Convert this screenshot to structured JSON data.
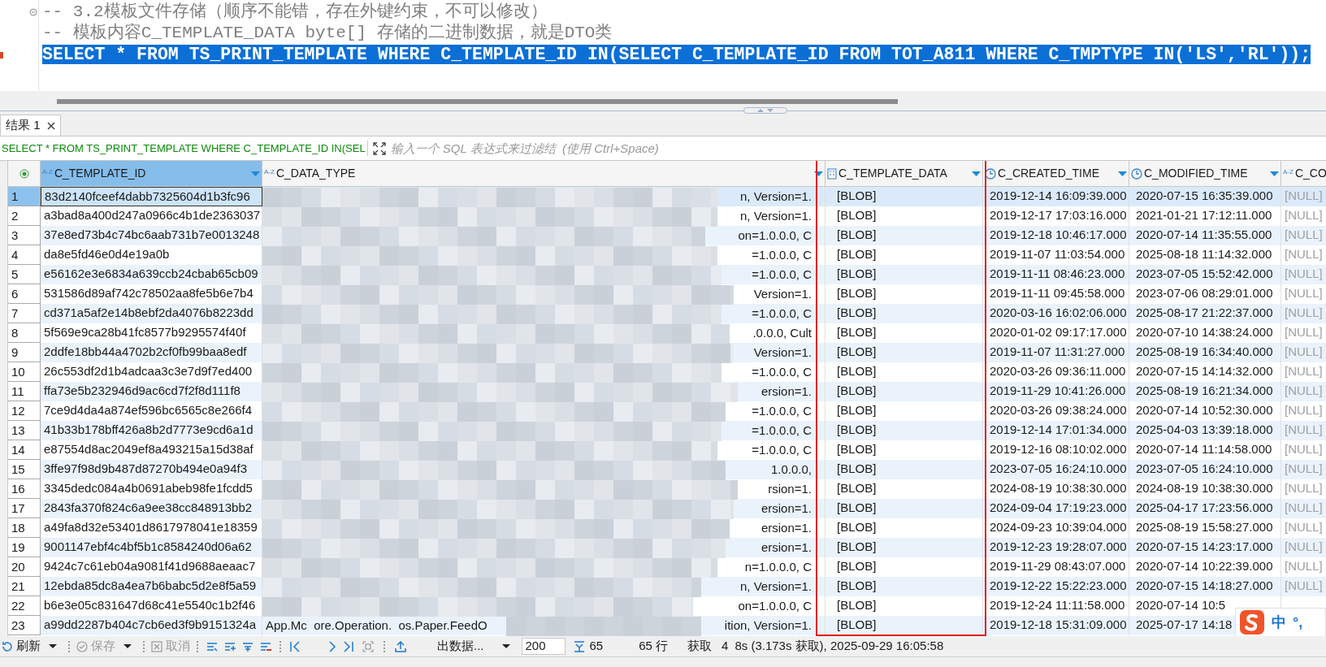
{
  "editor": {
    "lines": [
      {
        "kind": "comment",
        "text": "-- 3.2模板文件存储（顺序不能错，存在外键约束，不可以修改）"
      },
      {
        "kind": "comment",
        "text": "-- 模板内容C_TEMPLATE_DATA byte[] 存储的二进制数据，就是DTO类"
      },
      {
        "kind": "code",
        "selected": true,
        "text": "SELECT * FROM TS_PRINT_TEMPLATE WHERE C_TEMPLATE_ID IN(SELECT C_TEMPLATE_ID FROM TOT_A811 WHERE C_TMPTYPE IN('LS','RL'));"
      }
    ]
  },
  "results_tab": {
    "label": "结果 1",
    "selected": true
  },
  "filter": {
    "query_text": "SELECT * FROM TS_PRINT_TEMPLATE WHERE C_TEMPLATE_ID IN(SEL",
    "placeholder": "输入一个 SQL 表达式来过滤结  (使用 Ctrl+Space)"
  },
  "table": {
    "columns": [
      {
        "name": "C_TEMPLATE_ID",
        "kind": "string",
        "icon_text": "A-Z",
        "selected": true
      },
      {
        "name": "C_DATA_TYPE",
        "kind": "string",
        "icon_text": "A-Z",
        "selected": false
      },
      {
        "name": "C_TEMPLATE_DATA",
        "kind": "binary",
        "selected": false
      },
      {
        "name": "C_CREATED_TIME",
        "kind": "datetime",
        "selected": false
      },
      {
        "name": "C_MODIFIED_TIME",
        "kind": "datetime",
        "selected": false
      },
      {
        "name": "C_CO",
        "kind": "string",
        "icon_text": "A-Z",
        "selected": false
      }
    ],
    "rows": [
      {
        "number": "1",
        "selected": true,
        "template_id": "83d2140fceef4dabb7325604d1b3fc96",
        "data_type_tail": "n, Version=1.",
        "template_data": "[BLOB]",
        "created_time": "2019-12-14 16:09:39.000",
        "modified_time": "2020-07-15 16:35:39.000",
        "column_6": "[NULL]"
      },
      {
        "number": "2",
        "selected": false,
        "template_id": "a3bad8a400d247a0966c4b1de2363037",
        "data_type_tail": "n, Version=1.",
        "template_data": "[BLOB]",
        "created_time": "2019-12-17 17:03:16.000",
        "modified_time": "2021-01-21 17:12:11.000",
        "column_6": "[NULL]"
      },
      {
        "number": "3",
        "selected": false,
        "template_id": "37e8ed73b4c74bc6aab731b7e0013248",
        "data_type_tail": "on=1.0.0.0, C",
        "template_data": "[BLOB]",
        "created_time": "2019-12-18 10:46:17.000",
        "modified_time": "2020-07-14 11:35:55.000",
        "column_6": "[NULL]"
      },
      {
        "number": "4",
        "selected": false,
        "template_id": "da8e5fd46e0d4e19a0b",
        "data_type_tail": "=1.0.0.0, C",
        "template_data": "[BLOB]",
        "created_time": "2019-11-07 11:03:54.000",
        "modified_time": "2025-08-18 11:14:32.000",
        "column_6": "[NULL]"
      },
      {
        "number": "5",
        "selected": false,
        "template_id": "e56162e3e6834a639ccb24cbab65cb09",
        "data_type_tail": "=1.0.0.0, C",
        "template_data": "[BLOB]",
        "created_time": "2019-11-11 08:46:23.000",
        "modified_time": "2023-07-05 15:52:42.000",
        "column_6": "[NULL]"
      },
      {
        "number": "6",
        "selected": false,
        "template_id": "531586d89af742c78502aa8fe5b6e7b4",
        "data_type_tail": "Version=1.",
        "template_data": "[BLOB]",
        "created_time": "2019-11-11 09:45:58.000",
        "modified_time": "2023-07-06 08:29:01.000",
        "column_6": "[NULL]"
      },
      {
        "number": "7",
        "selected": false,
        "template_id": "cd371a5af2e14b8ebf2da4076b8223dd",
        "data_type_tail": "=1.0.0.0, C",
        "template_data": "[BLOB]",
        "created_time": "2020-03-16 16:02:06.000",
        "modified_time": "2025-08-17 21:22:37.000",
        "column_6": "[NULL]"
      },
      {
        "number": "8",
        "selected": false,
        "template_id": "5f569e9ca28b41fc8577b9295574f40f",
        "data_type_tail": ".0.0.0, Cult",
        "template_data": "[BLOB]",
        "created_time": "2020-01-02 09:17:17.000",
        "modified_time": "2020-07-10 14:38:24.000",
        "column_6": "[NULL]"
      },
      {
        "number": "9",
        "selected": false,
        "template_id": "2ddfe18bb44a4702b2cf0fb99baa8edf",
        "data_type_tail": "Version=1.",
        "template_data": "[BLOB]",
        "created_time": "2019-11-07 11:31:27.000",
        "modified_time": "2025-08-19 16:34:40.000",
        "column_6": "[NULL]"
      },
      {
        "number": "10",
        "selected": false,
        "template_id": "26c553df2d1b4adcaa3c3e7d9f7ed400",
        "data_type_tail": "=1.0.0.0, C",
        "template_data": "[BLOB]",
        "created_time": "2020-03-26 09:36:11.000",
        "modified_time": "2020-07-15 14:14:32.000",
        "column_6": "[NULL]"
      },
      {
        "number": "11",
        "selected": false,
        "template_id": "ffa73e5b232946d9ac6cd7f2f8d111f8",
        "data_type_tail": "ersion=1.",
        "template_data": "[BLOB]",
        "created_time": "2019-11-29 10:41:26.000",
        "modified_time": "2025-08-19 16:21:34.000",
        "column_6": "[NULL]"
      },
      {
        "number": "12",
        "selected": false,
        "template_id": "7ce9d4da4a874ef596bc6565c8e266f4",
        "data_type_tail": "=1.0.0.0, C",
        "template_data": "[BLOB]",
        "created_time": "2020-03-26 09:38:24.000",
        "modified_time": "2020-07-14 10:52:30.000",
        "column_6": "[NULL]"
      },
      {
        "number": "13",
        "selected": false,
        "template_id": "41b33b178bff426a8b2d7773e9cd6a1d",
        "data_type_tail": "=1.0.0.0, C",
        "template_data": "[BLOB]",
        "created_time": "2019-12-14 17:01:34.000",
        "modified_time": "2025-04-03 13:39:18.000",
        "column_6": "[NULL]"
      },
      {
        "number": "14",
        "selected": false,
        "template_id": "e87554d8ac2049ef8a493215a15d38af",
        "data_type_tail": "=1.0.0.0, C",
        "template_data": "[BLOB]",
        "created_time": "2019-12-16 08:10:02.000",
        "modified_time": "2020-07-14 11:14:58.000",
        "column_6": "[NULL]"
      },
      {
        "number": "15",
        "selected": false,
        "template_id": "3ffe97f98d9b487d87270b494e0a94f3",
        "data_type_tail": "1.0.0.0,",
        "template_data": "[BLOB]",
        "created_time": "2023-07-05 16:24:10.000",
        "modified_time": "2023-07-05 16:24:10.000",
        "column_6": "[NULL]"
      },
      {
        "number": "16",
        "selected": false,
        "template_id": "3345dedc084a4b0691abeb98fe1fcdd5",
        "data_type_tail": "rsion=1.",
        "template_data": "[BLOB]",
        "created_time": "2024-08-19 10:38:30.000",
        "modified_time": "2024-08-19 10:38:30.000",
        "column_6": "[NULL]"
      },
      {
        "number": "17",
        "selected": false,
        "template_id": "2843fa370f824c6a9ee38cc848913bb2",
        "data_type_tail": "ersion=1.",
        "template_data": "[BLOB]",
        "created_time": "2024-09-04 17:19:23.000",
        "modified_time": "2025-04-17 17:23:56.000",
        "column_6": "[NULL]"
      },
      {
        "number": "18",
        "selected": false,
        "template_id": "a49fa8d32e53401d8617978041e18359",
        "data_type_tail": "ersion=1.",
        "template_data": "[BLOB]",
        "created_time": "2024-09-23 10:39:04.000",
        "modified_time": "2025-08-19 15:58:27.000",
        "column_6": "[NULL]"
      },
      {
        "number": "19",
        "selected": false,
        "template_id": "9001147ebf4c4bf5b1c8584240d06a62",
        "data_type_tail": "ersion=1.",
        "template_data": "[BLOB]",
        "created_time": "2019-12-23 19:28:07.000",
        "modified_time": "2020-07-15 14:23:17.000",
        "column_6": "[NULL]"
      },
      {
        "number": "20",
        "selected": false,
        "template_id": "9424c7c61eb04a9081f41d9688aeaac7",
        "data_type_tail": "n=1.0.0.0, C",
        "template_data": "[BLOB]",
        "created_time": "2019-11-29 08:43:07.000",
        "modified_time": "2020-07-14 10:22:39.000",
        "column_6": "[NULL]"
      },
      {
        "number": "21",
        "selected": false,
        "template_id": "12ebda85dc8a4ea7b6babc5d2e8f5a59",
        "data_type_tail": "n, Version=1.",
        "template_data": "[BLOB]",
        "created_time": "2019-12-22 15:22:23.000",
        "modified_time": "2020-07-15 14:18:27.000",
        "column_6": "[NULL]"
      },
      {
        "number": "22",
        "selected": false,
        "template_id": "b6e3e05c831647d68c41e5540c1b2f46",
        "data_type_tail": "on=1.0.0.0, C",
        "template_data": "[BLOB]",
        "created_time": "2019-12-24 11:11:58.000",
        "modified_time": "2020-07-14 10:5"
      },
      {
        "number": "23",
        "selected": false,
        "template_id": "a99dd2287b404c7cb6ed3f9b9151324a",
        "data_type_head": "App.Mc  ore.Operation.  os.Paper.FeedO",
        "data_type_tail": "ition, Version=1.",
        "template_data": "[BLOB]",
        "created_time": "2019-12-18 15:31:09.000",
        "modified_time": "2025-07-17 14:18"
      }
    ]
  },
  "toolbar": {
    "buttons": [
      {
        "label": "刷新",
        "disabled": false
      },
      {
        "label": "保存",
        "disabled": true
      },
      {
        "label": "取消",
        "disabled": true
      }
    ],
    "export_label": "出数据...",
    "fetch_size": "200",
    "fetched_count": "65",
    "row_count": "65 行",
    "fetch_label": "获取",
    "duration_part": "4",
    "status_text": "8s (3.173s 获取), 2025-09-29 16:05:58"
  },
  "ime": {
    "labels": [
      "中",
      "°,"
    ]
  }
}
